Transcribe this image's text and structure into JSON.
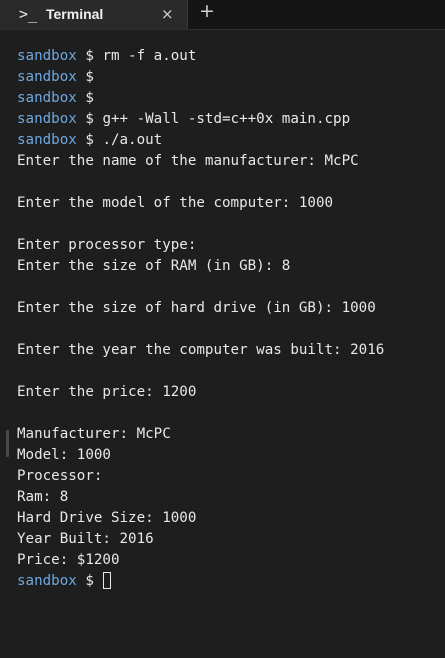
{
  "tab": {
    "icon": "terminal-icon",
    "icon_glyph": ">_",
    "title": "Terminal",
    "close_glyph": "×",
    "new_tab_glyph": "+"
  },
  "colors": {
    "background": "#1e1e1e",
    "tabbar": "#141414",
    "prompt": "#6ea8e0",
    "text": "#e8e8e8"
  },
  "terminal": {
    "prompt": "sandbox",
    "prompt_symbol": "$",
    "lines": [
      {
        "type": "cmd",
        "text": "rm -f a.out"
      },
      {
        "type": "cmd",
        "text": ""
      },
      {
        "type": "cmd",
        "text": ""
      },
      {
        "type": "cmd",
        "text": "g++ -Wall -std=c++0x main.cpp"
      },
      {
        "type": "cmd",
        "text": "./a.out"
      },
      {
        "type": "out",
        "text": "Enter the name of the manufacturer: McPC"
      },
      {
        "type": "out",
        "text": ""
      },
      {
        "type": "out",
        "text": "Enter the model of the computer: 1000"
      },
      {
        "type": "out",
        "text": ""
      },
      {
        "type": "out",
        "text": "Enter processor type:"
      },
      {
        "type": "out",
        "text": "Enter the size of RAM (in GB): 8"
      },
      {
        "type": "out",
        "text": ""
      },
      {
        "type": "out",
        "text": "Enter the size of hard drive (in GB): 1000"
      },
      {
        "type": "out",
        "text": ""
      },
      {
        "type": "out",
        "text": "Enter the year the computer was built: 2016"
      },
      {
        "type": "out",
        "text": ""
      },
      {
        "type": "out",
        "text": "Enter the price: 1200"
      },
      {
        "type": "out",
        "text": ""
      },
      {
        "type": "out",
        "text": "Manufacturer: McPC"
      },
      {
        "type": "out",
        "text": "Model: 1000"
      },
      {
        "type": "out",
        "text": "Processor:"
      },
      {
        "type": "out",
        "text": "Ram: 8"
      },
      {
        "type": "out",
        "text": "Hard Drive Size: 1000"
      },
      {
        "type": "out",
        "text": "Year Built: 2016"
      },
      {
        "type": "out",
        "text": "Price: $1200"
      },
      {
        "type": "prompt",
        "text": ""
      }
    ]
  }
}
